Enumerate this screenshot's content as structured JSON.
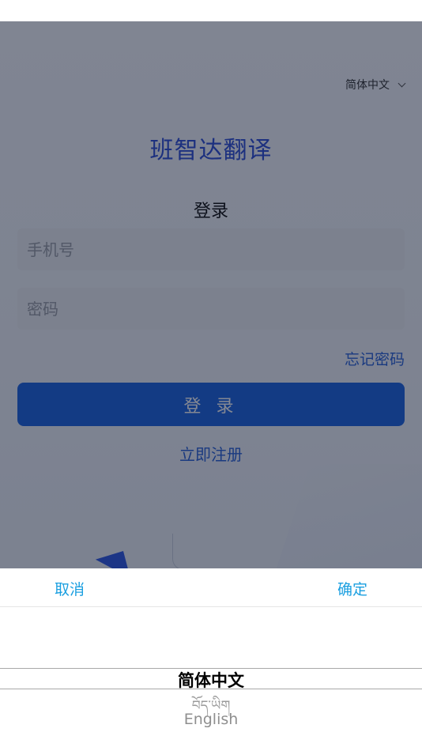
{
  "login": {
    "language_selector": "简体中文",
    "app_title": "班智达翻译",
    "heading": "登录",
    "phone_placeholder": "手机号",
    "password_placeholder": "密码",
    "forgot_password": "忘记密码",
    "login_button": "登 录",
    "register_link": "立即注册"
  },
  "picker": {
    "cancel_label": "取消",
    "confirm_label": "确定",
    "options": [
      "简体中文",
      "བོད་ཡིག",
      "English"
    ],
    "selected_index": 0
  },
  "colors": {
    "accent": "#2e4fd6",
    "button": "#1d64e0",
    "picker_action": "#1a9fe0",
    "overlay": "rgba(10,18,40,0.5)"
  }
}
